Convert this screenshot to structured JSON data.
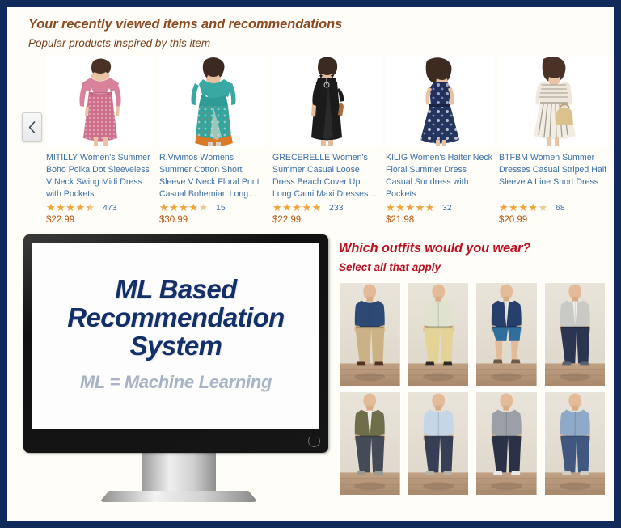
{
  "theme": {
    "border_color": "#102a5c",
    "page_bg": "#fffdf7",
    "heading_color": "#8c4a23",
    "link_color": "#3b6ea5",
    "price_color": "#b8530b",
    "star_color": "#f0a33c",
    "question_color": "#bb1122",
    "screen_title_color": "#13306b",
    "screen_sub_color": "#a8b4c6"
  },
  "recommendations": {
    "title": "Your recently viewed items and recommendations",
    "subtitle": "Popular products inspired by this item",
    "prev_button_label": "‹",
    "products": [
      {
        "title": "MITILLY Women's Summer Boho Polka Dot Sleeveless V Neck Swing Midi Dress with Pockets",
        "rating": 4,
        "reviews": "473",
        "price": "$22.99",
        "image": "pink-polka-dot-midi-dress"
      },
      {
        "title": "R.Vivimos Womens Summer Cotton Short Sleeve V Neck Floral Print Casual Bohemian Long…",
        "rating": 3.5,
        "reviews": "15",
        "price": "$30.99",
        "image": "teal-floral-boho-maxi-dress"
      },
      {
        "title": "GRECERELLE Women's Summer Casual Loose Dress Beach Cover Up Long Cami Maxi Dresses…",
        "rating": 4.5,
        "reviews": "233",
        "price": "$22.99",
        "image": "black-cami-maxi-dress"
      },
      {
        "title": "KILIG Women's Halter Neck Floral Summer Dress Casual Sundress with Pockets",
        "rating": 4.5,
        "reviews": "32",
        "price": "$21.98",
        "image": "navy-floral-halter-sundress"
      },
      {
        "title": "BTFBM Women Summer Dresses Casual Striped Half Sleeve A Line Short Dress",
        "rating": 3.5,
        "reviews": "68",
        "price": "$20.99",
        "image": "striped-a-line-short-dress"
      }
    ]
  },
  "screen": {
    "title_line1": "ML Based",
    "title_line2": "Recommendation",
    "title_line3": "System",
    "subtitle": "ML = Machine Learning"
  },
  "survey": {
    "question": "Which outfits would you wear?",
    "instruction": "Select all that apply",
    "outfits": [
      {
        "label": "navy-button-shirt-khaki-pants",
        "top": "#2d4a74",
        "bottom": "#cbb286",
        "shoe": "#53331f"
      },
      {
        "label": "floral-print-shirt-yellow-pants",
        "top": "#dfe2cf",
        "bottom": "#e3d396",
        "shoe": "#2f2a26"
      },
      {
        "label": "navy-jacket-blue-swim-shorts",
        "top": "#26406b",
        "bottom": "#2f6f9e",
        "shoe": "#6b5a48"
      },
      {
        "label": "grey-cardigan-dark-jeans",
        "top": "#c9c9c6",
        "bottom": "#2c3550",
        "shoe": "#5a6272"
      },
      {
        "label": "olive-cardigan-rust-tee-grey-jeans",
        "top": "#6f6e4a",
        "bottom": "#454a57",
        "shoe": "#9a9a90"
      },
      {
        "label": "light-blue-plaid-shirt-navy-pants",
        "top": "#c5d6e6",
        "bottom": "#363f55",
        "shoe": "#b6b2a4"
      },
      {
        "label": "grey-raglan-tee-dark-jeans",
        "top": "#9aa0a6",
        "bottom": "#2b3247",
        "shoe": "#e7e7e7"
      },
      {
        "label": "blue-check-shirt-medium-jeans",
        "top": "#8fa9c8",
        "bottom": "#40587f",
        "shoe": "#cfcfc8"
      }
    ]
  }
}
